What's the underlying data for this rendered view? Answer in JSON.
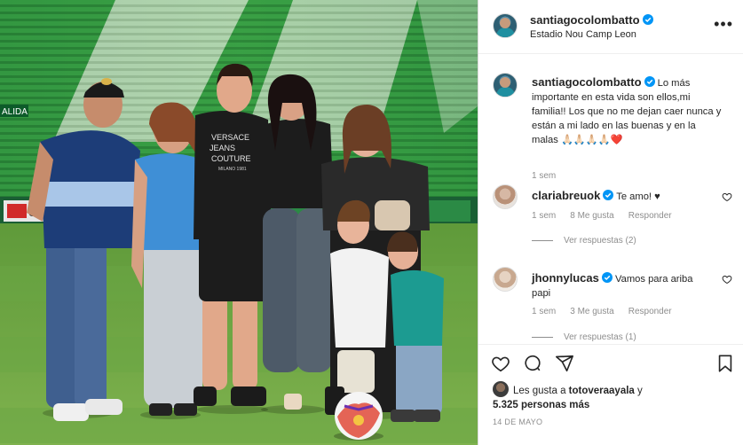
{
  "header": {
    "username": "santiagocolombatto",
    "location": "Estadio Nou Camp Leon",
    "more_label": "•••"
  },
  "photo": {
    "stadium_signage": "ALIDA",
    "shirt_text_line1": "VERSACE",
    "shirt_text_line2": "JEANS",
    "shirt_text_line3": "COUTURE",
    "shirt_text_line4": "MILANO 1981",
    "ad_board_text": "CA"
  },
  "caption": {
    "username": "santiagocolombatto",
    "text": " Lo más importante en esta vida son ellos,mi familia!! Los que no me dejan caer nunca y están a mi lado en las buenas y en la malas 🙏🏻🙏🏻🙏🏻🙏🏻❤️",
    "time": "1 sem"
  },
  "comments": [
    {
      "username": "clariabreuok",
      "text": "Te amo! ♥",
      "time": "1 sem",
      "likes": "8 Me gusta",
      "reply": "Responder",
      "view_replies": "Ver respuestas (2)"
    },
    {
      "username": "jhonnylucas",
      "text": "Vamos para ariba papi",
      "time": "1 sem",
      "likes": "3 Me gusta",
      "reply": "Responder",
      "view_replies": "Ver respuestas (1)"
    }
  ],
  "actions": {
    "likes_prefix": "Les gusta a ",
    "liked_by": "totoveraayala",
    "likes_middle": " y",
    "likes_count": "5.325 personas más",
    "date": "14 DE MAYO"
  },
  "colors": {
    "verified": "#0095f6",
    "muted": "#8e8e8e",
    "text": "#262626",
    "border": "#dbdbdb"
  },
  "icons": [
    "verified-badge-icon",
    "more-options-icon",
    "like-heart-icon",
    "comment-icon",
    "share-icon",
    "save-bookmark-icon",
    "comment-like-icon"
  ]
}
